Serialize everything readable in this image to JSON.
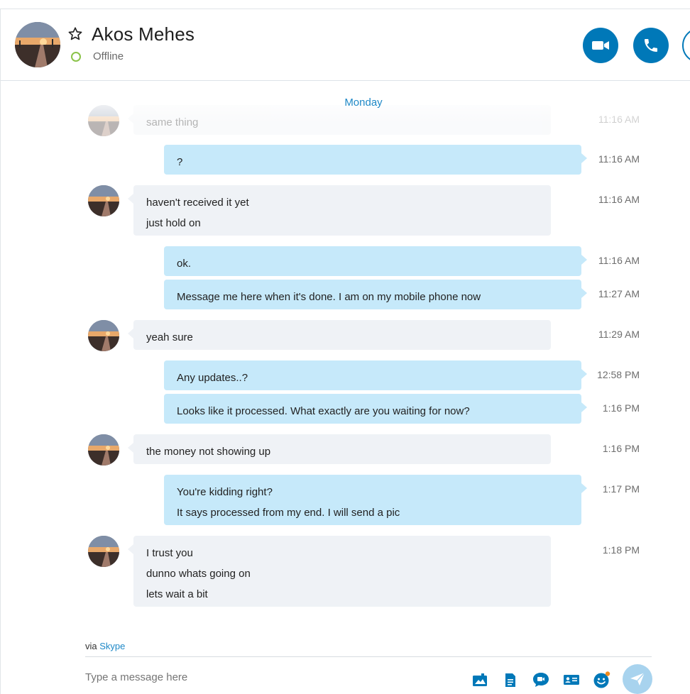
{
  "header": {
    "contact_name": "Akos Mehes",
    "status": "Offline"
  },
  "conversation": {
    "date_divider": "Monday",
    "faded_message": {
      "text": "same thing",
      "time": "11:16 AM"
    },
    "messages": [
      {
        "from": "me",
        "lines": [
          "?"
        ],
        "time": "11:16 AM"
      },
      {
        "from": "them",
        "lines": [
          "haven't received it yet",
          "just hold on"
        ],
        "time": "11:16 AM"
      },
      {
        "from": "me",
        "lines": [
          "ok."
        ],
        "time": "11:16 AM"
      },
      {
        "from": "me",
        "lines": [
          "Message me here when it's done. I am on my mobile phone now"
        ],
        "time": "11:27 AM"
      },
      {
        "from": "them",
        "lines": [
          "yeah sure"
        ],
        "time": "11:29 AM"
      },
      {
        "from": "me",
        "lines": [
          "Any updates..?"
        ],
        "time": "12:58 PM"
      },
      {
        "from": "me",
        "lines": [
          "Looks like it processed. What exactly are you waiting for now?"
        ],
        "time": "1:16 PM"
      },
      {
        "from": "them",
        "lines": [
          "the money not showing up"
        ],
        "time": "1:16 PM"
      },
      {
        "from": "me",
        "lines": [
          "You're kidding right?",
          "It says processed from my end. I will send a pic"
        ],
        "time": "1:17 PM"
      },
      {
        "from": "them",
        "lines": [
          "I trust you",
          "dunno whats going on",
          "lets wait a bit"
        ],
        "time": "1:18 PM"
      }
    ]
  },
  "footer": {
    "via_prefix": "via",
    "via_link": "Skype",
    "compose_placeholder": "Type a message here"
  },
  "colors": {
    "accent": "#0078b8",
    "my_bubble": "#c6e9fa",
    "their_bubble": "#eff2f6",
    "presence": "#8bc34a",
    "emoticon_badge": "#f28c1e"
  },
  "icons": [
    "star-icon",
    "video-call-icon",
    "phone-icon",
    "media-icon",
    "file-icon",
    "video-message-icon",
    "contact-card-icon",
    "emoticon-icon",
    "send-icon"
  ]
}
